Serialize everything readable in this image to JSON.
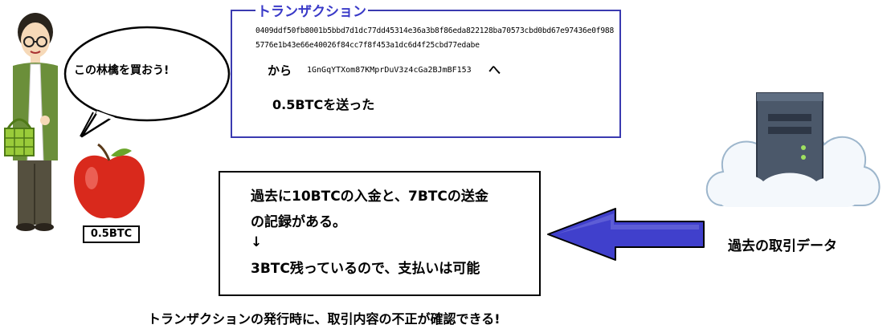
{
  "transaction": {
    "title": "トランザクション",
    "hash": "0409ddf50fb8001b5bbd7d1dc77dd45314e36a3b8f86eda822128ba70573cbd0bd67e97436e0f9885776e1b43e66e40026f84cc7f8f453a1dc6d4f25cbd77edabe",
    "from_label": "から",
    "address": "1GnGqYTXom87KMprDuV3z4cGa2BJmBF153",
    "to_label": "へ",
    "sent": "0.5BTCを送った"
  },
  "speech": {
    "text": "この林檎を買おう!"
  },
  "price_tag": "0.5BTC",
  "verification": {
    "lines": [
      "過去に10BTCの入金と、7BTCの送金",
      "の記録がある。",
      "↓",
      "3BTC残っているので、支払いは可能"
    ]
  },
  "cloud_caption": "過去の取引データ",
  "bottom_caption": "トランザクションの発行時に、取引内容の不正が確認できる!",
  "colors": {
    "tx_border": "#3a3ab0",
    "tx_title": "#3a3ac8",
    "arrow": "#4040cc",
    "apple": "#d9291c",
    "shirt": "#6b8f3a"
  }
}
